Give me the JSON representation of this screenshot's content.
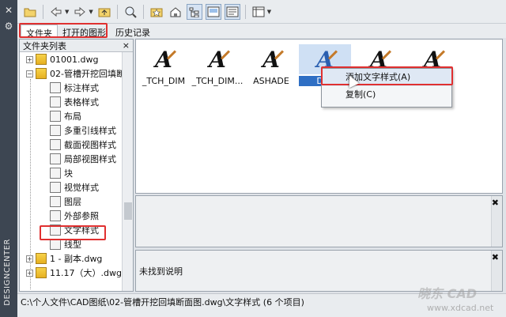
{
  "side": {
    "close_glyph": "✕",
    "pin_glyph": "⚙",
    "title": "DESIGNCENTER"
  },
  "toolbar": {
    "icons": [
      "open-folder-icon",
      "back-icon",
      "forward-icon",
      "up-folder-icon",
      "search-icon",
      "favorites-icon",
      "home-icon",
      "tree-toggle-icon",
      "preview-icon",
      "description-icon",
      "views-icon"
    ]
  },
  "tabs": [
    "文件夹",
    "打开的图形",
    "历史记录"
  ],
  "tree": {
    "header": "文件夹列表",
    "close": "×",
    "items": [
      {
        "label": "01001.dwg",
        "level": 0,
        "pm": "+"
      },
      {
        "label": "02-管槽开挖回填断",
        "level": 0,
        "pm": "-"
      },
      {
        "label": "标注样式",
        "level": 1
      },
      {
        "label": "表格样式",
        "level": 1
      },
      {
        "label": "布局",
        "level": 1
      },
      {
        "label": "多重引线样式",
        "level": 1
      },
      {
        "label": "截面视图样式",
        "level": 1
      },
      {
        "label": "局部视图样式",
        "level": 1
      },
      {
        "label": "块",
        "level": 1
      },
      {
        "label": "视觉样式",
        "level": 1
      },
      {
        "label": "图层",
        "level": 1
      },
      {
        "label": "外部参照",
        "level": 1
      },
      {
        "label": "文字样式",
        "level": 1
      },
      {
        "label": "线型",
        "level": 1
      },
      {
        "label": "1 - 副本.dwg",
        "level": 0,
        "pm": "+"
      },
      {
        "label": "11.17（大）.dwg",
        "level": 0,
        "pm": "+"
      }
    ]
  },
  "content": {
    "items": [
      "_TCH_DIM",
      "_TCH_DIM...",
      "ASHADE",
      "DIM",
      "",
      ""
    ],
    "glyph": "A"
  },
  "context_menu": [
    "添加文字样式(A)",
    "复制(C)"
  ],
  "preview_close": "✖",
  "description": {
    "text": "未找到说明",
    "close": "✖"
  },
  "status": "C:\\个人文件\\CAD图纸\\02-管槽开挖回填断面图.dwg\\文字样式 (6 个项目)",
  "watermark": {
    "line1": "晓东 CAD",
    "line2": "www.xdcad.net"
  }
}
